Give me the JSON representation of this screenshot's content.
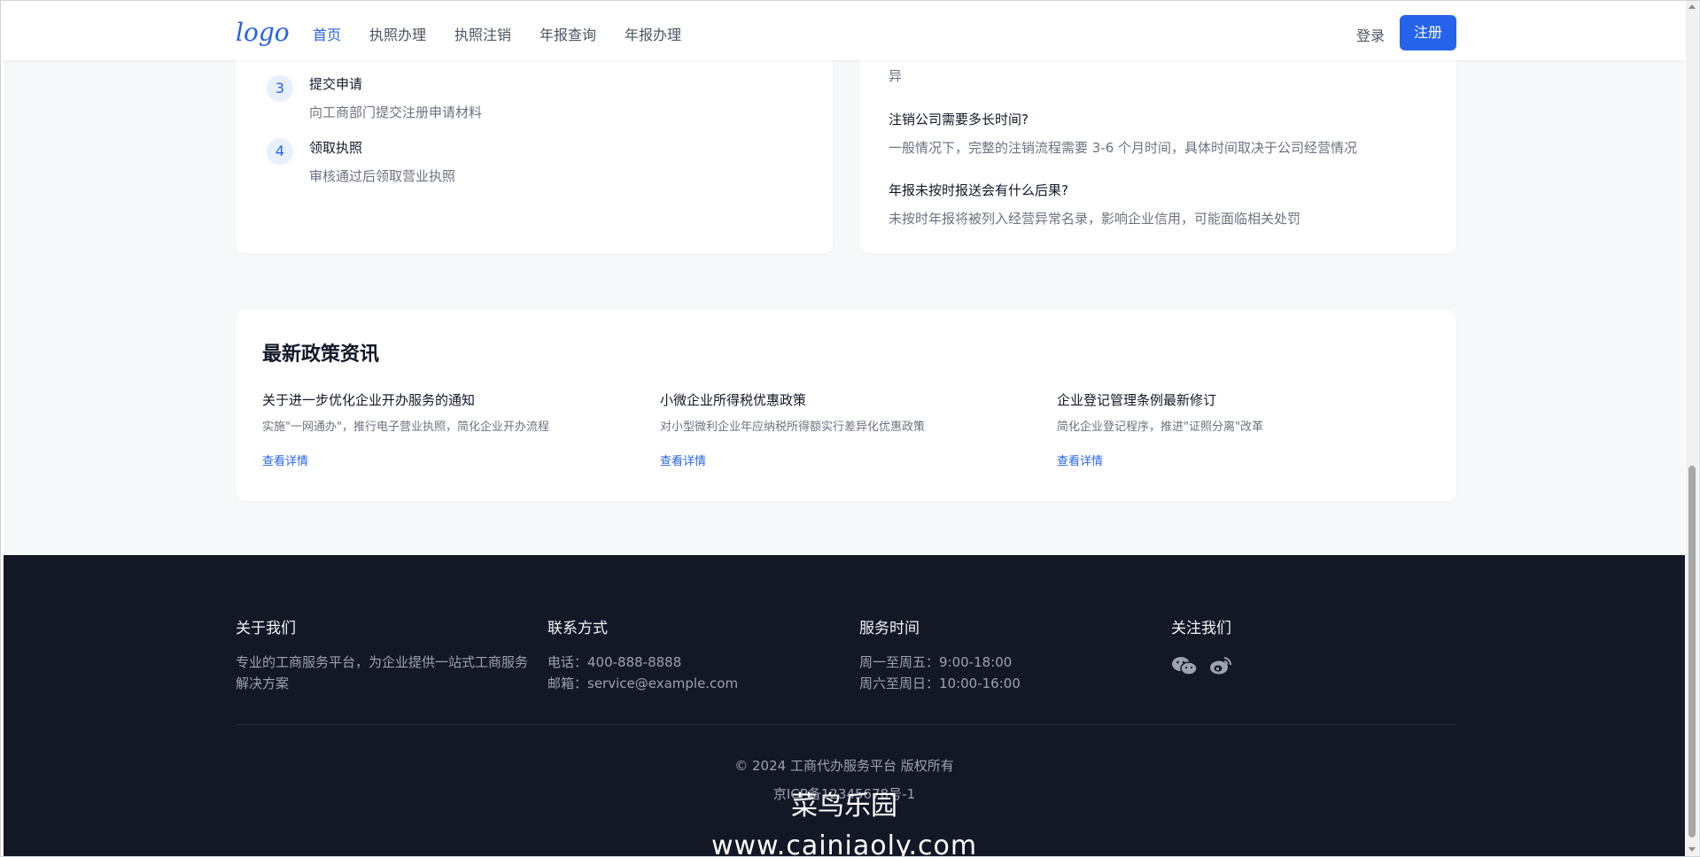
{
  "nav": {
    "logo": "logo",
    "links": [
      "首页",
      "执照办理",
      "执照注销",
      "年报查询",
      "年报办理"
    ],
    "login": "登录",
    "register": "注册"
  },
  "steps": [
    {
      "num": "3",
      "title": "提交申请",
      "desc": "向工商部门提交注册申请材料"
    },
    {
      "num": "4",
      "title": "领取执照",
      "desc": "审核通过后领取营业执照"
    }
  ],
  "faq": {
    "prev_tail": "异",
    "items": [
      {
        "q": "注销公司需要多长时间?",
        "a": "一般情况下，完整的注销流程需要 3-6 个月时间，具体时间取决于公司经营情况"
      },
      {
        "q": "年报未按时报送会有什么后果?",
        "a": "未按时年报将被列入经营异常名录，影响企业信用，可能面临相关处罚"
      }
    ]
  },
  "news": {
    "title": "最新政策资讯",
    "items": [
      {
        "title": "关于进一步优化企业开办服务的通知",
        "desc": "实施\"一网通办\"，推行电子营业执照，简化企业开办流程",
        "link": "查看详情"
      },
      {
        "title": "小微企业所得税优惠政策",
        "desc": "对小型微利企业年应纳税所得额实行差异化优惠政策",
        "link": "查看详情"
      },
      {
        "title": "企业登记管理条例最新修订",
        "desc": "简化企业登记程序，推进\"证照分离\"改革",
        "link": "查看详情"
      }
    ]
  },
  "footer": {
    "about": {
      "title": "关于我们",
      "text": "专业的工商服务平台，为企业提供一站式工商服务解决方案"
    },
    "contact": {
      "title": "联系方式",
      "phone": "电话：400-888-8888",
      "email": "邮箱：service@example.com"
    },
    "hours": {
      "title": "服务时间",
      "weekday": "周一至周五：9:00-18:00",
      "weekend": "周六至周日：10:00-16:00"
    },
    "follow": {
      "title": "关注我们",
      "icons": [
        "wechat-icon",
        "weibo-icon"
      ]
    },
    "copyright": "© 2024 工商代办服务平台 版权所有",
    "icp": "京ICP备12345678号-1"
  },
  "watermark": {
    "line1": "菜鸟乐园",
    "line2": "www.cainiaoly.com"
  },
  "colors": {
    "accent": "#2563eb",
    "footer_bg": "#121826"
  }
}
